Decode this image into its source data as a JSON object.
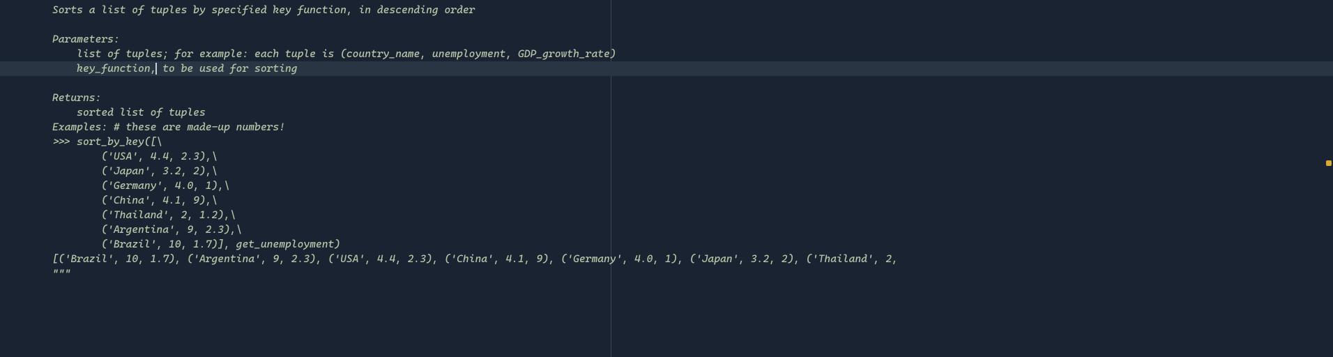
{
  "colors": {
    "background": "#1a2332",
    "docstring": "#b8c5a8",
    "highlight": "#2a3544",
    "ruler": "#3a4452",
    "scroll_marker": "#d8a83a"
  },
  "editor": {
    "font_family": "monospace",
    "ruler_column": 80,
    "highlighted_line_index": 4,
    "cursor": {
      "line_index": 4,
      "after_text": "    key_function,"
    }
  },
  "lines": [
    "Sorts a list of tuples by specified key function, in descending order",
    "",
    "Parameters:",
    "    list of tuples; for example: each tuple is (country_name, unemployment, GDP_growth_rate)",
    "    key_function, to be used for sorting",
    "",
    "Returns:",
    "    sorted list of tuples",
    "Examples: # these are made-up numbers!",
    ">>> sort_by_key([\\",
    "        ('USA', 4.4, 2.3),\\",
    "        ('Japan', 3.2, 2),\\",
    "        ('Germany', 4.0, 1),\\",
    "        ('China', 4.1, 9),\\",
    "        ('Thailand', 2, 1.2),\\",
    "        ('Argentina', 9, 2.3),\\",
    "        ('Brazil', 10, 1.7)], get_unemployment)",
    "[('Brazil', 10, 1.7), ('Argentina', 9, 2.3), ('USA', 4.4, 2.3), ('China', 4.1, 9), ('Germany', 4.0, 1), ('Japan', 3.2, 2), ('Thailand', 2,",
    "\"\"\""
  ],
  "cursor_line_before": "    key_function,",
  "cursor_line_after": " to be used for sorting"
}
